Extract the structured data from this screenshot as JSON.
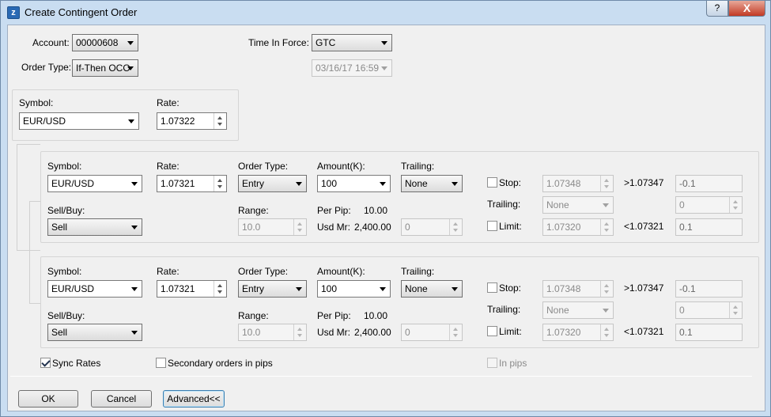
{
  "window": {
    "title": "Create Contingent Order",
    "help": "?",
    "close": "X"
  },
  "top": {
    "account_label": "Account:",
    "account_value": "00000608",
    "order_type_label": "Order Type:",
    "order_type_value": "If-Then OCO",
    "tif_label": "Time In Force:",
    "tif_value": "GTC",
    "expiry_value": "03/16/17 16:59"
  },
  "primary": {
    "symbol_label": "Symbol:",
    "symbol_value": "EUR/USD",
    "rate_label": "Rate:",
    "rate_value": "1.07322"
  },
  "orders": [
    {
      "symbol_label": "Symbol:",
      "symbol_value": "EUR/USD",
      "rate_label": "Rate:",
      "rate_value": "1.07321",
      "order_type_label": "Order Type:",
      "order_type_value": "Entry",
      "amount_label": "Amount(K):",
      "amount_value": "100",
      "trailing_label": "Trailing:",
      "trailing_value": "None",
      "sellbuy_label": "Sell/Buy:",
      "sellbuy_value": "Sell",
      "range_label": "Range:",
      "range_value": "10.0",
      "perpip_label": "Per Pip:",
      "perpip_value": "10.00",
      "usdmr_label": "Usd Mr:",
      "usdmr_value": "2,400.00",
      "range_extra_value": "0",
      "stop_label": "Stop:",
      "stop_rate": "1.07348",
      "stop_cond": ">1.07347",
      "stop_pips": "-0.1",
      "trailing2_label": "Trailing:",
      "trailing2_value": "None",
      "trailing2_num": "0",
      "limit_label": "Limit:",
      "limit_rate": "1.07320",
      "limit_cond": "<1.07321",
      "limit_pips": "0.1"
    },
    {
      "symbol_label": "Symbol:",
      "symbol_value": "EUR/USD",
      "rate_label": "Rate:",
      "rate_value": "1.07321",
      "order_type_label": "Order Type:",
      "order_type_value": "Entry",
      "amount_label": "Amount(K):",
      "amount_value": "100",
      "trailing_label": "Trailing:",
      "trailing_value": "None",
      "sellbuy_label": "Sell/Buy:",
      "sellbuy_value": "Sell",
      "range_label": "Range:",
      "range_value": "10.0",
      "perpip_label": "Per Pip:",
      "perpip_value": "10.00",
      "usdmr_label": "Usd Mr:",
      "usdmr_value": "2,400.00",
      "range_extra_value": "0",
      "stop_label": "Stop:",
      "stop_rate": "1.07348",
      "stop_cond": ">1.07347",
      "stop_pips": "-0.1",
      "trailing2_label": "Trailing:",
      "trailing2_value": "None",
      "trailing2_num": "0",
      "limit_label": "Limit:",
      "limit_rate": "1.07320",
      "limit_cond": "<1.07321",
      "limit_pips": "0.1"
    }
  ],
  "options": {
    "sync_rates": "Sync Rates",
    "secondary_pips": "Secondary orders in pips",
    "in_pips": "In pips"
  },
  "buttons": {
    "ok": "OK",
    "cancel": "Cancel",
    "advanced": "Advanced<<"
  }
}
